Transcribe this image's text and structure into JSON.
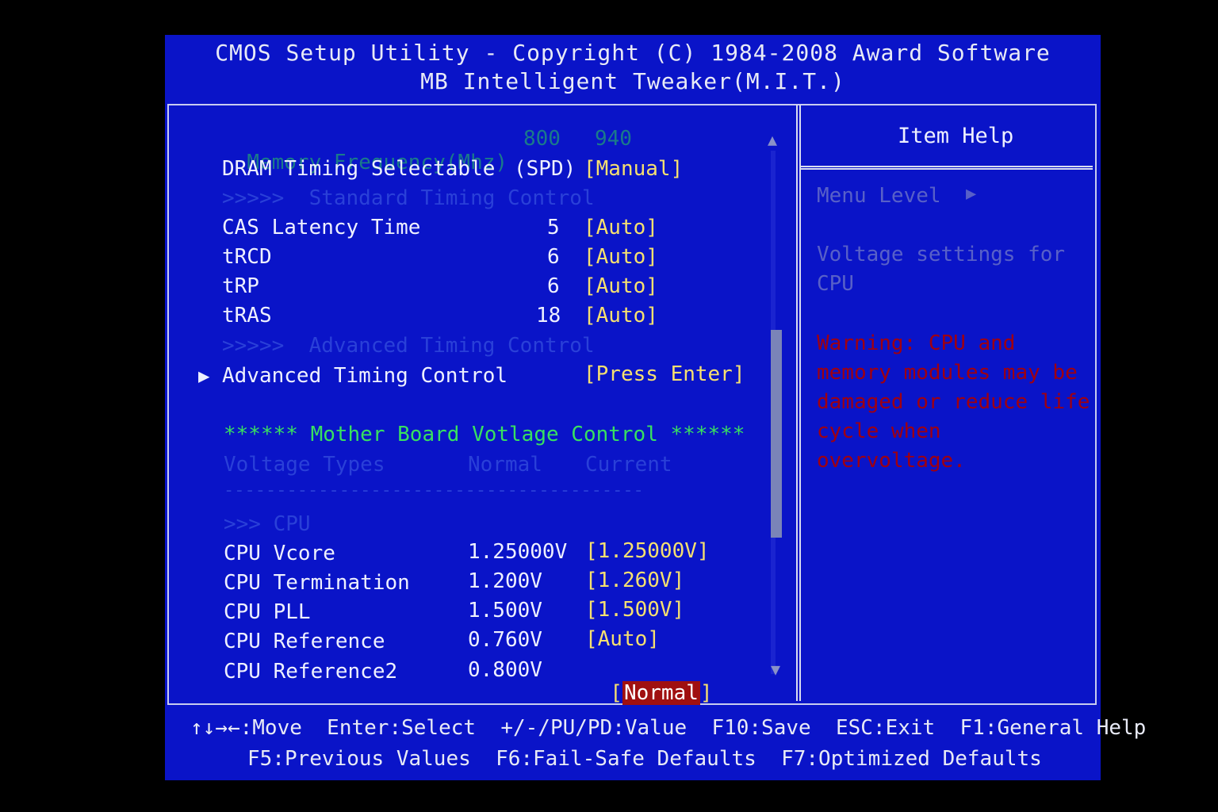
{
  "header": {
    "line1": "CMOS Setup Utility - Copyright (C) 1984-2008 Award Software",
    "line2": "MB Intelligent Tweaker(M.I.T.)"
  },
  "items": {
    "mem_freq": {
      "label": "Memory Frequency(Mhz)",
      "default": "800",
      "current": "940"
    },
    "dram_timing": {
      "label": "DRAM Timing Selectable",
      "default": "(SPD)",
      "value": "[Manual]"
    },
    "std_header": ">>>>>  Standard Timing Control",
    "cas": {
      "label": "CAS Latency Time",
      "default": "5",
      "value": "[Auto]"
    },
    "trcd": {
      "label": "tRCD",
      "default": "6",
      "value": "[Auto]"
    },
    "trp": {
      "label": "tRP",
      "default": "6",
      "value": "[Auto]"
    },
    "tras": {
      "label": "tRAS",
      "default": "18",
      "value": "[Auto]"
    },
    "adv_header": ">>>>>  Advanced Timing Control",
    "adv_timing": {
      "label": "Advanced Timing Control",
      "value": "[Press Enter]"
    },
    "volt_section": "****** Mother Board Votlage Control ******",
    "volt_cols": {
      "types": "Voltage Types",
      "normal": "Normal",
      "current": "Current"
    },
    "volt_rule": "----------------------------------------",
    "cpu_header": ">>> CPU",
    "cpu_vcore": {
      "label": "CPU Vcore",
      "normal": "1.25000V",
      "value": "[1.25000V]"
    },
    "cpu_term": {
      "label": "CPU Termination",
      "normal": "1.200V",
      "value": "[1.260V]"
    },
    "cpu_pll": {
      "label": "CPU PLL",
      "normal": "1.500V",
      "value": "[1.500V]"
    },
    "cpu_ref": {
      "label": "CPU Reference",
      "normal": "0.760V",
      "value": "[Auto]"
    },
    "cpu_ref2": {
      "label": "CPU Reference2",
      "normal": "0.800V",
      "value_open": "[",
      "value": "Normal",
      "value_close": "]"
    }
  },
  "help": {
    "title": "Item Help",
    "menu_level": "Menu Level",
    "menu_level_arrow": "▶",
    "desc_line1": "Voltage settings for",
    "desc_line2": "CPU",
    "warn1": "Warning: CPU and",
    "warn2": "memory modules may be",
    "warn3": "damaged or reduce life",
    "warn4": "cycle when",
    "warn5": "overvoltage."
  },
  "footer": {
    "line1": "↑↓→←:Move  Enter:Select  +/-/PU/PD:Value  F10:Save  ESC:Exit  F1:General Help",
    "line2": "F5:Previous Values  F6:Fail-Safe Defaults  F7:Optimized Defaults"
  },
  "scroll": {
    "up": "▲",
    "down": "▼"
  },
  "colors": {
    "background": "#0a14c8",
    "highlight": "#a01010",
    "value": "#f6e070",
    "section": "#38e060",
    "warning": "#a00010"
  }
}
